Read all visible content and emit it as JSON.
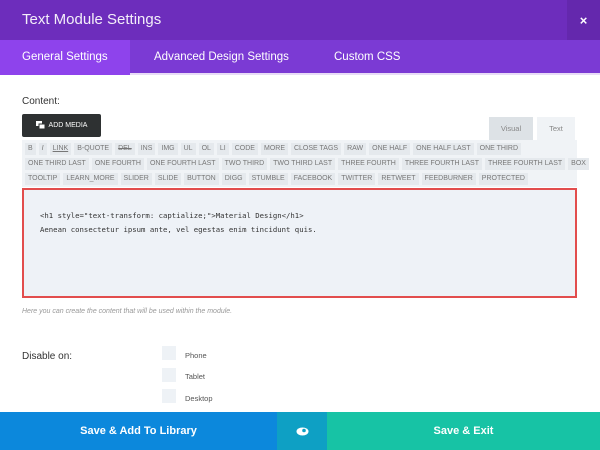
{
  "header": {
    "title": "Text Module Settings",
    "close_icon": "×"
  },
  "tabs": [
    {
      "label": "General Settings"
    },
    {
      "label": "Advanced Design Settings"
    },
    {
      "label": "Custom CSS"
    }
  ],
  "content": {
    "label": "Content:",
    "add_media": "ADD MEDIA",
    "visual_tab": "Visual",
    "text_tab": "Text"
  },
  "quicktags": [
    [
      "B",
      "I",
      "LINK",
      "B-QUOTE",
      "DEL",
      "INS",
      "IMG",
      "UL",
      "OL",
      "LI",
      "CODE",
      "MORE",
      "CLOSE TAGS",
      "RAW",
      "ONE HALF",
      "ONE HALF LAST",
      "ONE THIRD"
    ],
    [
      "ONE THIRD LAST",
      "ONE FOURTH",
      "ONE FOURTH LAST",
      "TWO THIRD",
      "TWO THIRD LAST",
      "THREE FOURTH",
      "THREE FOURTH LAST",
      "THREE FOURTH LAST",
      "BOX"
    ],
    [
      "TOOLTIP",
      "LEARN_MORE",
      "SLIDER",
      "SLIDE",
      "BUTTON",
      "DIGG",
      "STUMBLE",
      "FACEBOOK",
      "TWITTER",
      "RETWEET",
      "FEEDBURNER",
      "PROTECTED"
    ]
  ],
  "editor": {
    "value": "<h1 style=\"text-transform: captialize;\">Material Design</h1>\nAenean consectetur ipsum ante, vel egestas enim tincidunt quis."
  },
  "help": "Here you can create the content that will be used within the module.",
  "disable": {
    "label": "Disable on:",
    "options": [
      "Phone",
      "Tablet",
      "Desktop"
    ]
  },
  "footer": {
    "save_library": "Save & Add To Library",
    "save_exit": "Save & Exit"
  },
  "colors": {
    "header": "#6d2dbc",
    "tabs": "#7b3ad4",
    "active_tab": "#8e43ec",
    "blue": "#0c88dc",
    "teal": "#0ea0c4",
    "green": "#17c3a5"
  }
}
